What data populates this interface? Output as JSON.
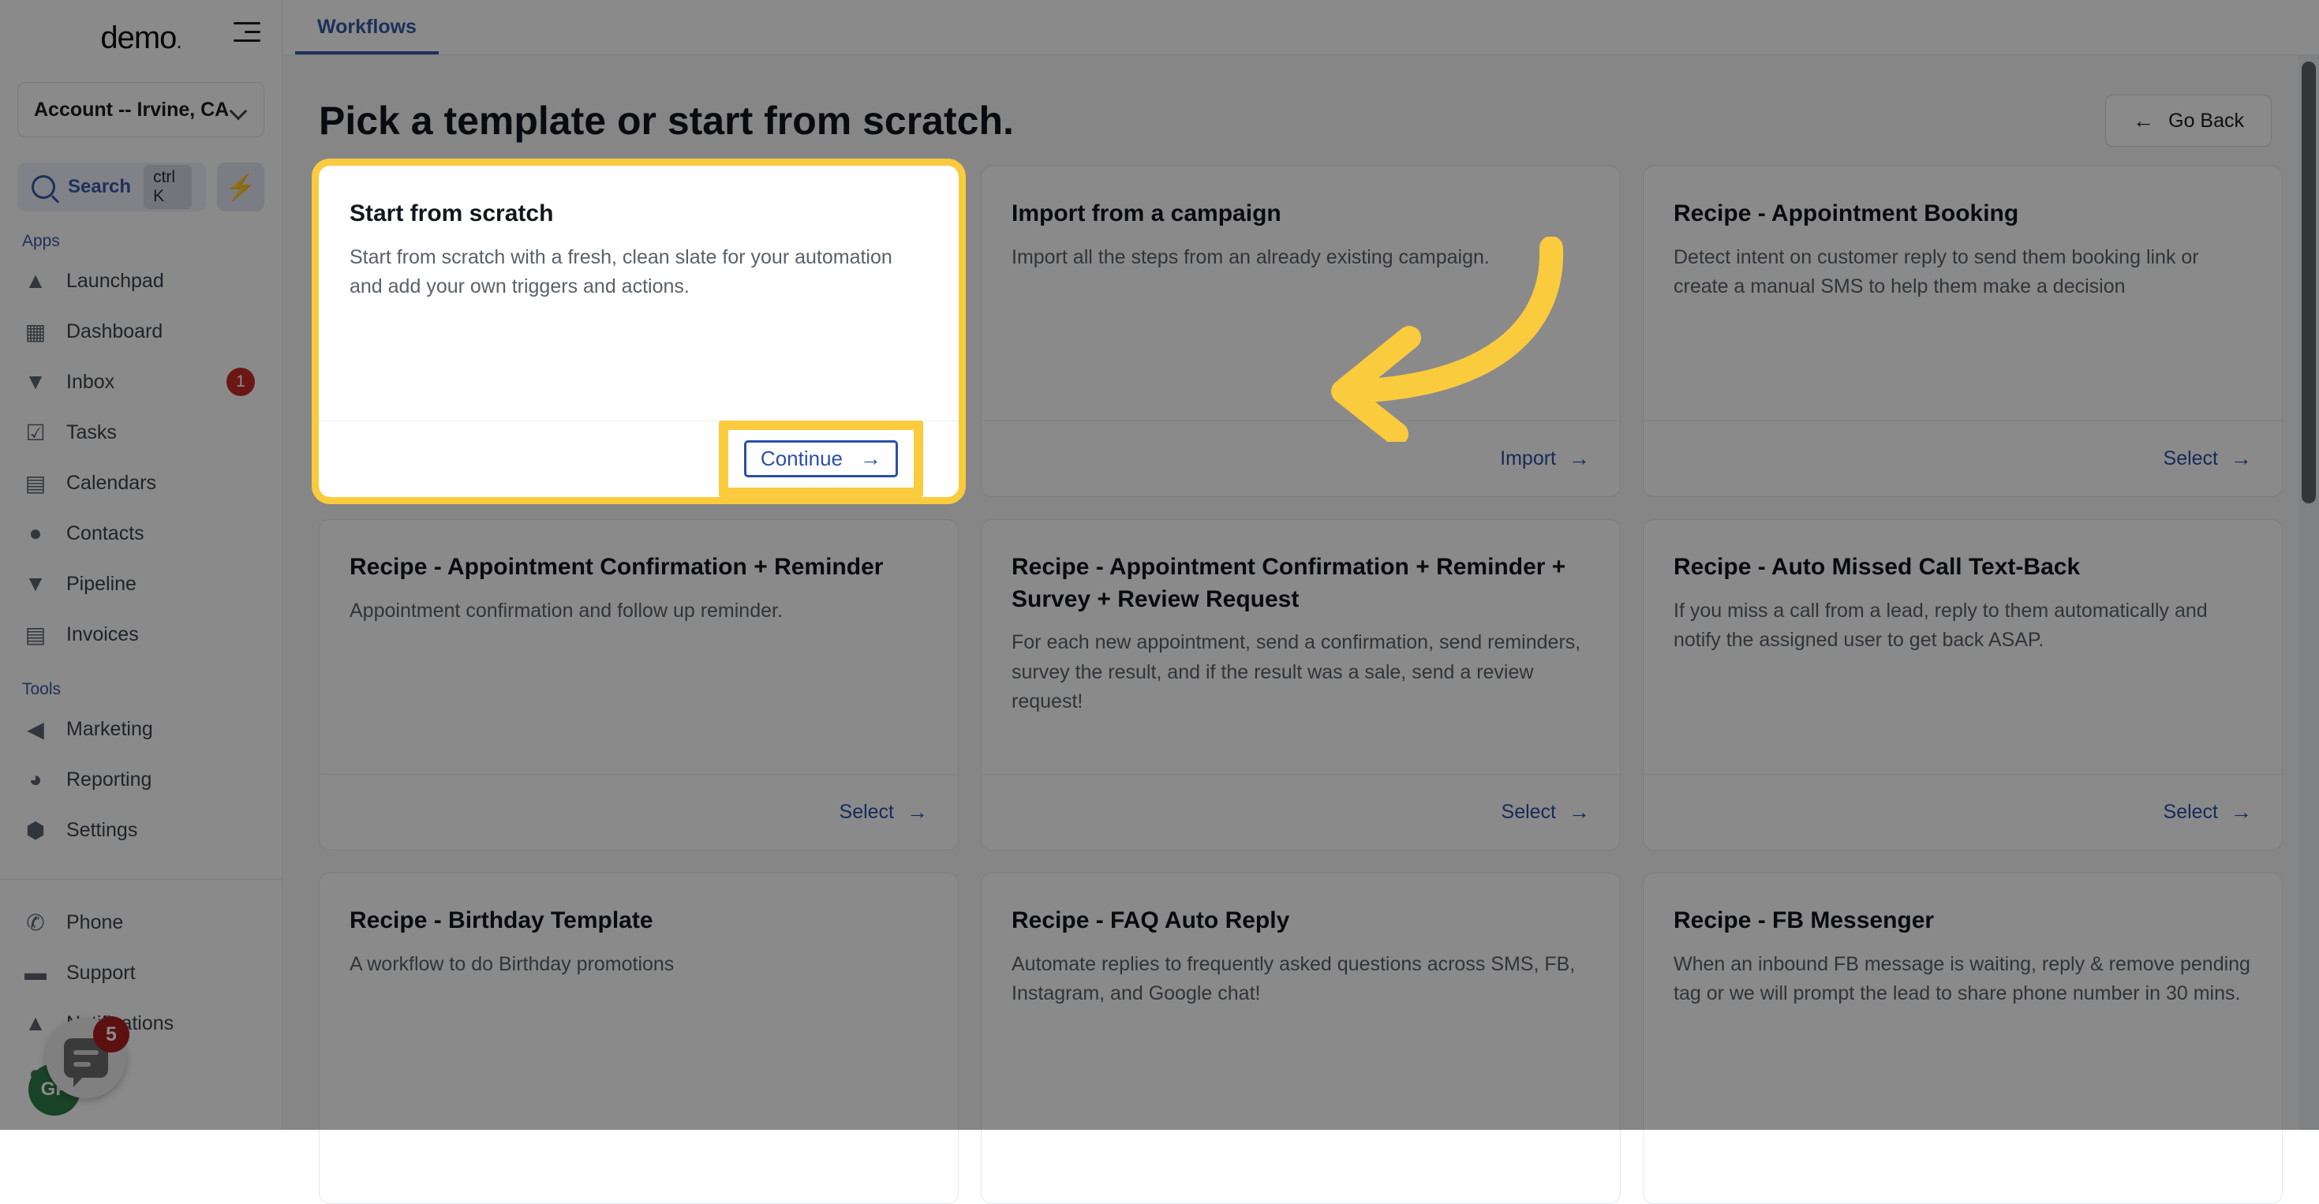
{
  "sidebar": {
    "brand": "demo",
    "brand_dot": ".",
    "account": {
      "label": "Account -- Irvine, CA",
      "chevron_icon": "chevron-down-icon"
    },
    "search": {
      "label": "Search",
      "shortcut": "ctrl K",
      "icon": "search-icon"
    },
    "quick_action_icon": "lightning-bolt-icon",
    "apps_section_label": "Apps",
    "tools_section_label": "Tools",
    "apps": [
      {
        "label": "Launchpad",
        "icon": "rocket-icon",
        "badge": ""
      },
      {
        "label": "Dashboard",
        "icon": "grid-icon",
        "badge": ""
      },
      {
        "label": "Inbox",
        "icon": "inbox-icon",
        "badge": "1"
      },
      {
        "label": "Tasks",
        "icon": "clipboard-check-icon",
        "badge": ""
      },
      {
        "label": "Calendars",
        "icon": "calendar-icon",
        "badge": ""
      },
      {
        "label": "Contacts",
        "icon": "person-icon",
        "badge": ""
      },
      {
        "label": "Pipeline",
        "icon": "funnel-icon",
        "badge": ""
      },
      {
        "label": "Invoices",
        "icon": "invoice-icon",
        "badge": ""
      }
    ],
    "tools": [
      {
        "label": "Marketing",
        "icon": "megaphone-icon",
        "badge": ""
      },
      {
        "label": "Reporting",
        "icon": "pie-chart-icon",
        "badge": ""
      },
      {
        "label": "Settings",
        "icon": "gear-icon",
        "badge": ""
      }
    ],
    "bottom": [
      {
        "label": "Phone",
        "icon": "phone-icon",
        "badge": ""
      },
      {
        "label": "Support",
        "icon": "chat-dots-icon",
        "badge": ""
      },
      {
        "label": "Notifications",
        "icon": "bell-icon",
        "badge": ""
      },
      {
        "label": "Profile",
        "icon": "avatar-icon",
        "badge": ""
      }
    ],
    "avatar_initials": "GP",
    "chat_widget": {
      "icon": "chat-bubble-icon",
      "badge": "5"
    }
  },
  "header": {
    "menu_icon": "hamburger-menu-icon",
    "tabs": [
      {
        "label": "Workflows",
        "active": true
      }
    ]
  },
  "main": {
    "page_title": "Pick a template or start from scratch.",
    "go_back": {
      "label": "Go Back",
      "icon": "arrow-left-icon"
    }
  },
  "cards": [
    {
      "title": "Start from scratch",
      "desc": "Start from scratch with a fresh, clean slate for your automation and add your own triggers and actions.",
      "action": "Continue",
      "action_icon": "arrow-right-icon",
      "highlighted": true
    },
    {
      "title": "Import from a campaign",
      "desc": "Import all the steps from an already existing campaign.",
      "action": "Import",
      "action_icon": "arrow-right-icon",
      "highlighted": false
    },
    {
      "title": "Recipe - Appointment Booking",
      "desc": "Detect intent on customer reply to send them booking link or create a manual SMS to help them make a decision",
      "action": "Select",
      "action_icon": "arrow-right-icon",
      "highlighted": false
    },
    {
      "title": "Recipe - Appointment Confirmation + Reminder",
      "desc": "Appointment confirmation and follow up reminder.",
      "action": "Select",
      "action_icon": "arrow-right-icon",
      "highlighted": false
    },
    {
      "title": "Recipe - Appointment Confirmation + Reminder + Survey + Review Request",
      "desc": "For each new appointment, send a confirmation, send reminders, survey the result, and if the result was a sale, send a review request!",
      "action": "Select",
      "action_icon": "arrow-right-icon",
      "highlighted": false
    },
    {
      "title": "Recipe - Auto Missed Call Text-Back",
      "desc": "If you miss a call from a lead, reply to them automatically and notify the assigned user to get back ASAP.",
      "action": "Select",
      "action_icon": "arrow-right-icon",
      "highlighted": false
    },
    {
      "title": "Recipe - Birthday Template",
      "desc": "A workflow to do Birthday promotions",
      "action": "",
      "action_icon": "",
      "highlighted": false
    },
    {
      "title": "Recipe - FAQ Auto Reply",
      "desc": "Automate replies to frequently asked questions across SMS, FB, Instagram, and Google chat!",
      "action": "",
      "action_icon": "",
      "highlighted": false
    },
    {
      "title": "Recipe - FB Messenger",
      "desc": "When an inbound FB message is waiting, reply & remove pending tag or we will prompt the lead to share phone number in 30 mins.",
      "action": "",
      "action_icon": "",
      "highlighted": false
    }
  ],
  "annotation": {
    "arrow_icon": "curved-arrow-left-icon",
    "highlight_color": "#FBCB3E",
    "accent_color": "#2b4fa8"
  }
}
